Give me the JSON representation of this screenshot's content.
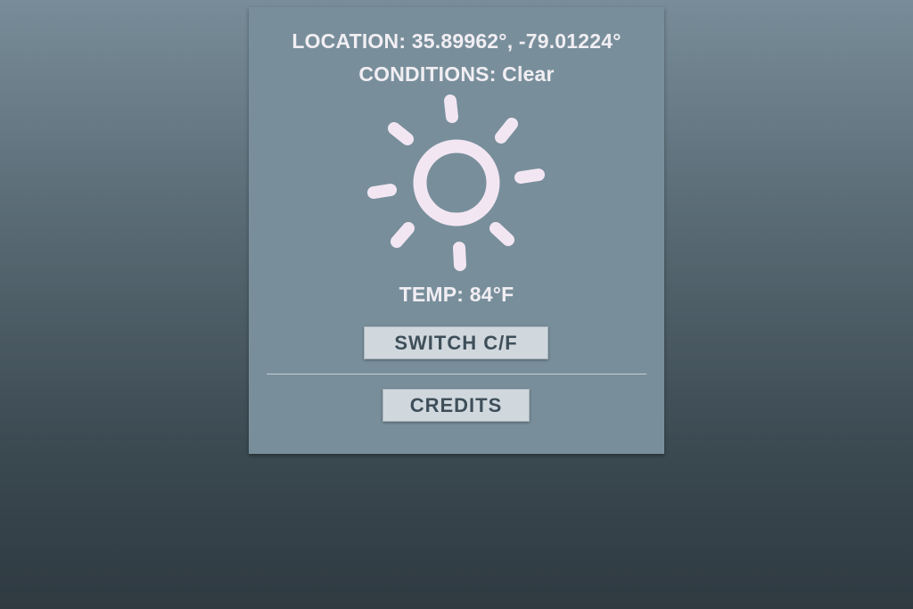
{
  "weather": {
    "location_text": "LOCATION: 35.89962°, -79.01224°",
    "conditions_text": "CONDITIONS: Clear",
    "temp_text": "TEMP: 84°F",
    "icon": "sun-icon",
    "icon_color": "#f3e6f3"
  },
  "buttons": {
    "switch_label": "SWITCH C/F",
    "credits_label": "CREDITS"
  },
  "colors": {
    "card_bg": "#788f9b",
    "text": "#f1eef3",
    "button_bg": "#d0d8de",
    "button_text": "#3f4f5a"
  }
}
